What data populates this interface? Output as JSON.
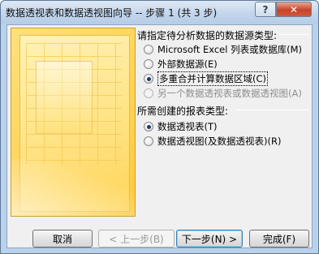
{
  "window": {
    "title": "数据透视表和数据透视图向导 -- 步骤 1 (共 3 步)",
    "help_glyph": "?",
    "close_glyph": "✕"
  },
  "section_source": {
    "heading": "请指定待分析数据的数据源类型:",
    "options": [
      {
        "label": "Microsoft Excel 列表或数据库(M)",
        "checked": false,
        "disabled": false
      },
      {
        "label": "外部数据源(E)",
        "checked": false,
        "disabled": false
      },
      {
        "label": "多重合并计算数据区域(C)",
        "checked": true,
        "disabled": false
      },
      {
        "label": "另一个数据透视表或数据透视图(A)",
        "checked": false,
        "disabled": true
      }
    ]
  },
  "section_report": {
    "heading": "所需创建的报表类型:",
    "options": [
      {
        "label": "数据透视表(T)",
        "checked": true
      },
      {
        "label": "数据透视图(及数据透视表)(R)",
        "checked": false
      }
    ]
  },
  "buttons": {
    "cancel": "取消",
    "back": "< 上一步(B)",
    "next": "下一步(N) >",
    "finish": "完成(F)"
  }
}
